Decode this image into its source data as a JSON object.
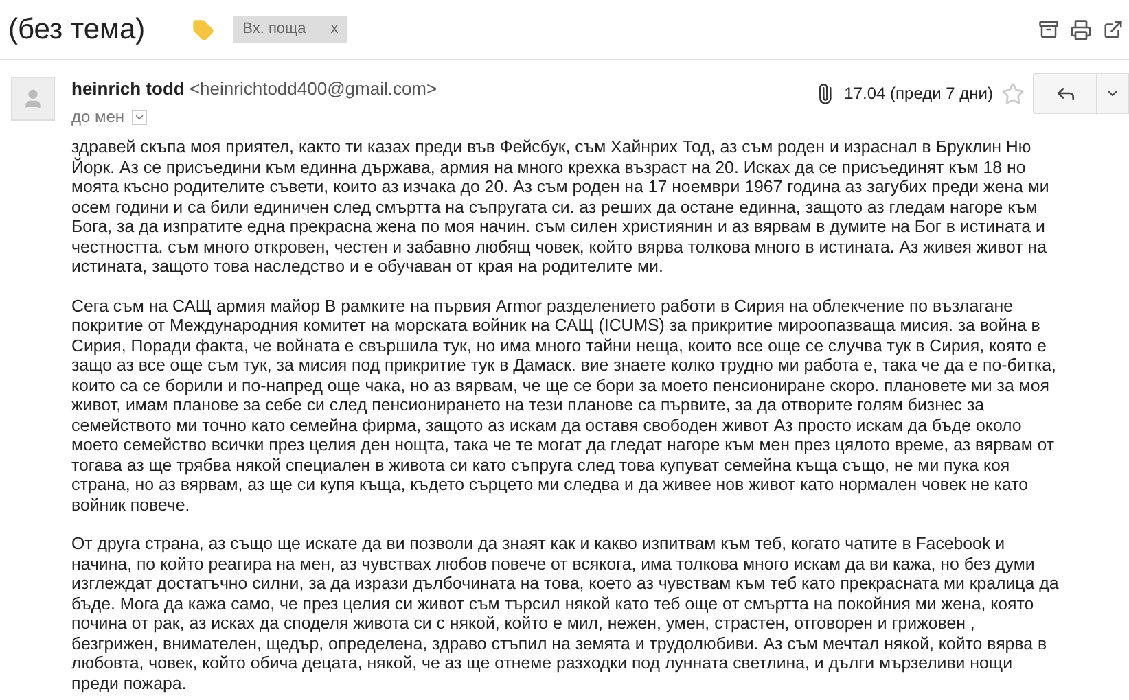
{
  "subject": "(без тема)",
  "label_chip": {
    "text": "Вх. поща",
    "close": "x"
  },
  "sender": {
    "name": "heinrich todd",
    "email": "<heinrichtodd400@gmail.com>",
    "recipient": "до мен"
  },
  "date": "17.04 (преди 7 дни)",
  "starred": false,
  "has_attachment": true,
  "body": [
    "здравей скъпа моя приятел, както ти казах преди във Фейсбук, съм Хайнрих Тод, аз съм роден и израснал в Бруклин Ню Йорк. Аз се присъедини към единна държава, армия на много крехка възраст на 20. Исках да се присъединят към 18 но моята късно родителите съвети, които аз изчака до 20. Аз съм роден на 17 ноември 1967 година аз загубих преди жена ми осем години и са били единичен след смъртта на съпругата си. аз реших да остане единна, защото аз гледам нагоре към Бога, за да изпратите една прекрасна жена по моя начин. съм силен християнин и аз вярвам в думите на Бог в истината и честността. съм много откровен, честен и забавно любящ човек, който вярва толкова много в истината. Аз живея живот на истината, защото това наследство и е обучаван от края на родителите ми.",
    "Сега съм на САЩ армия майор В рамките на първия Armor разделението работи в Сирия на облекчение по възлагане покритие от Международния комитет на морската войник на САЩ (ICUMS) за прикритие мироопазваща мисия. за война в Сирия, Поради факта, че войната е свършила тук, но има много тайни неща, които все още се случва тук в Сирия, която е защо аз все още съм тук, за мисия под прикритие тук в Дамаск. вие знаете колко трудно ми работа е, така че да е по-битка, които са се борили и по-напред още чака, но аз вярвам, че ще се бори за моето пенсиониране скоро. плановете ми за моя живот, имам планове за себе си след пенсионирането на тези планове са първите, за да отворите голям бизнес за семейството ми точно като семейна фирма, защото аз искам да оставя свободен живот Аз просто искам да бъде около моето семейство всички през целия ден нощта, така че те могат да гледат нагоре към мен през цялото време, аз вярвам от тогава аз ще трябва някой специален в живота си като съпруга след това купуват семейна къща също, не ми пука коя страна, но аз вярвам, аз ще си купя къща, където сърцето ми следва и да живее нов живот като нормален човек не като войник повече.",
    "От друга страна, аз също ще искате да ви позволи да знаят как и какво изпитвам към теб, когато чатите в Facebook и начина, по който реагира на мен, аз чувствах любов повече от всякога, има толкова много искам да ви кажа, но без думи изглеждат достатъчно силни, за да изрази дълбочината на това, което аз чувствам към теб като прекрасната ми кралица да бъде. Мога да кажа само, че през целия си живот съм търсил някой като теб още от смъртта на покойния ми жена, която почина от рак, аз исках да споделя живота си с някой, който е мил, нежен, умен, страстен, отговорен и грижовен , безгрижен, внимателен, щедър, определена, здраво стъпил на земята и трудолюбиви. Аз съм мечтал някой, който вярва в любовта, човек, който обича децата, някой, че аз ще отнеме разходки под лунната светлина, и дълги мързеливи нощи преди пожара."
  ]
}
